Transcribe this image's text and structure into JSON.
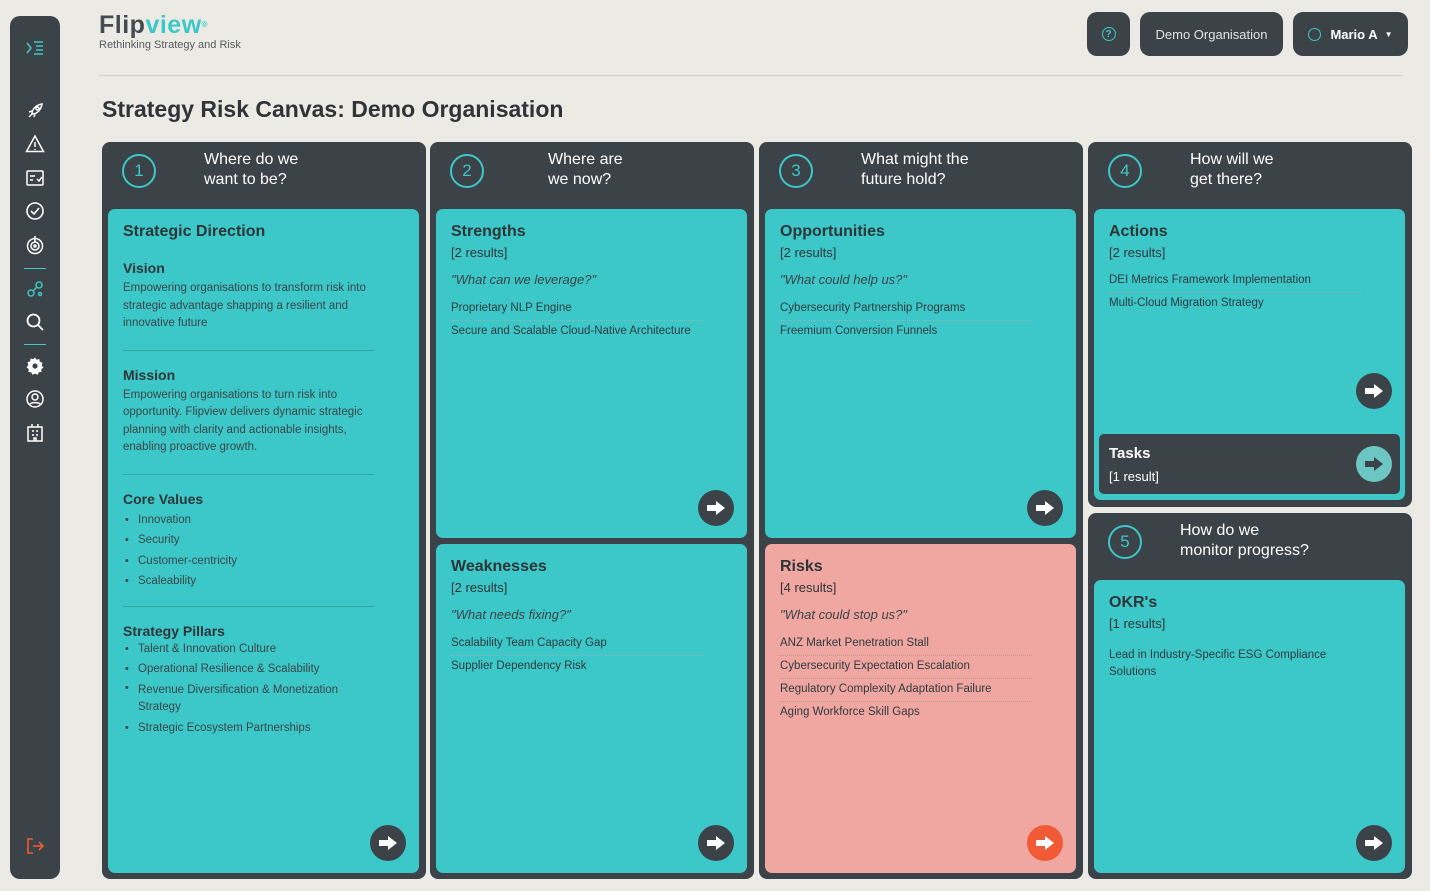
{
  "brand": {
    "logo_flip": "Flip",
    "logo_view": "view",
    "logo_reg": "®",
    "tagline": "Rethinking Strategy and Risk"
  },
  "header": {
    "help_symbol": "?",
    "org_button": "Demo Organisation",
    "user_button": "Mario A",
    "user_caret": "▼"
  },
  "page": {
    "title_bold": "Strategy Risk Canvas:",
    "title_org": " Demo Organisation"
  },
  "sidebar": {
    "icons": [
      "menu-collapse-icon",
      "rocket-icon",
      "warning-icon",
      "checklist-icon",
      "check-circle-icon",
      "target-icon",
      "nodes-icon",
      "search-icon",
      "gear-icon",
      "user-circle-icon",
      "organisation-icon",
      "logout-icon"
    ]
  },
  "columns": [
    {
      "num": "1",
      "q1": "Where do we",
      "q2": "want to be?"
    },
    {
      "num": "2",
      "q1": "Where are",
      "q2": "we now?"
    },
    {
      "num": "3",
      "q1": "What might the",
      "q2": "future hold?"
    },
    {
      "num": "4",
      "q1": "How will we",
      "q2": "get there?"
    },
    {
      "num": "5",
      "q1": "How do we",
      "q2": "monitor progress?"
    }
  ],
  "strategic_direction": {
    "title": "Strategic Direction",
    "vision_label": "Vision",
    "vision_text": "Empowering organisations to transform risk into strategic advantage shapping a resilient and innovative future",
    "mission_label": "Mission",
    "mission_text": "Empowering organisations to turn risk into opportunity. Flipview delivers dynamic strategic planning with clarity and actionable insights, enabling proactive growth.",
    "core_values_label": "Core Values",
    "core_values": [
      "Innovation",
      "Security",
      "Customer-centricity",
      "Scaleability"
    ],
    "pillars_label": "Strategy Pillars",
    "pillars": [
      "Talent & Innovation Culture",
      "Operational Resilience & Scalability",
      "Revenue Diversification & Monetization Strategy",
      "Strategic Ecosystem Partnerships"
    ]
  },
  "strengths": {
    "title": "Strengths",
    "count": "[2 results]",
    "question": "\"What can we leverage?\"",
    "items": [
      "Proprietary NLP Engine",
      "Secure and Scalable Cloud-Native Architecture"
    ]
  },
  "weaknesses": {
    "title": "Weaknesses",
    "count": "[2 results]",
    "question": "\"What needs fixing?\"",
    "items": [
      "Scalability Team Capacity Gap",
      "Supplier Dependency Risk"
    ]
  },
  "opportunities": {
    "title": "Opportunities",
    "count": "[2 results]",
    "question": "\"What could help us?\"",
    "items": [
      "Cybersecurity Partnership Programs",
      "Freemium Conversion Funnels"
    ]
  },
  "risks": {
    "title": "Risks",
    "count": "[4 results]",
    "question": "\"What could stop us?\"",
    "items": [
      "ANZ Market Penetration Stall",
      "Cybersecurity Expectation Escalation",
      "Regulatory Complexity Adaptation Failure",
      "Aging Workforce Skill Gaps"
    ]
  },
  "actions": {
    "title": "Actions",
    "count": "[2 results]",
    "items": [
      "DEI Metrics Framework Implementation",
      "Multi-Cloud Migration Strategy"
    ]
  },
  "tasks": {
    "title": "Tasks",
    "count": "[1 result]"
  },
  "okrs": {
    "title": "OKR's",
    "count": "[1 results]",
    "items": [
      "Lead in Industry-Specific ESG Compliance Solutions"
    ]
  },
  "colors": {
    "teal": "#3cc8c8",
    "dark": "#3b4248",
    "risk": "#f0a7a1",
    "risk_arrow": "#f05a35",
    "background": "#eceae5"
  }
}
